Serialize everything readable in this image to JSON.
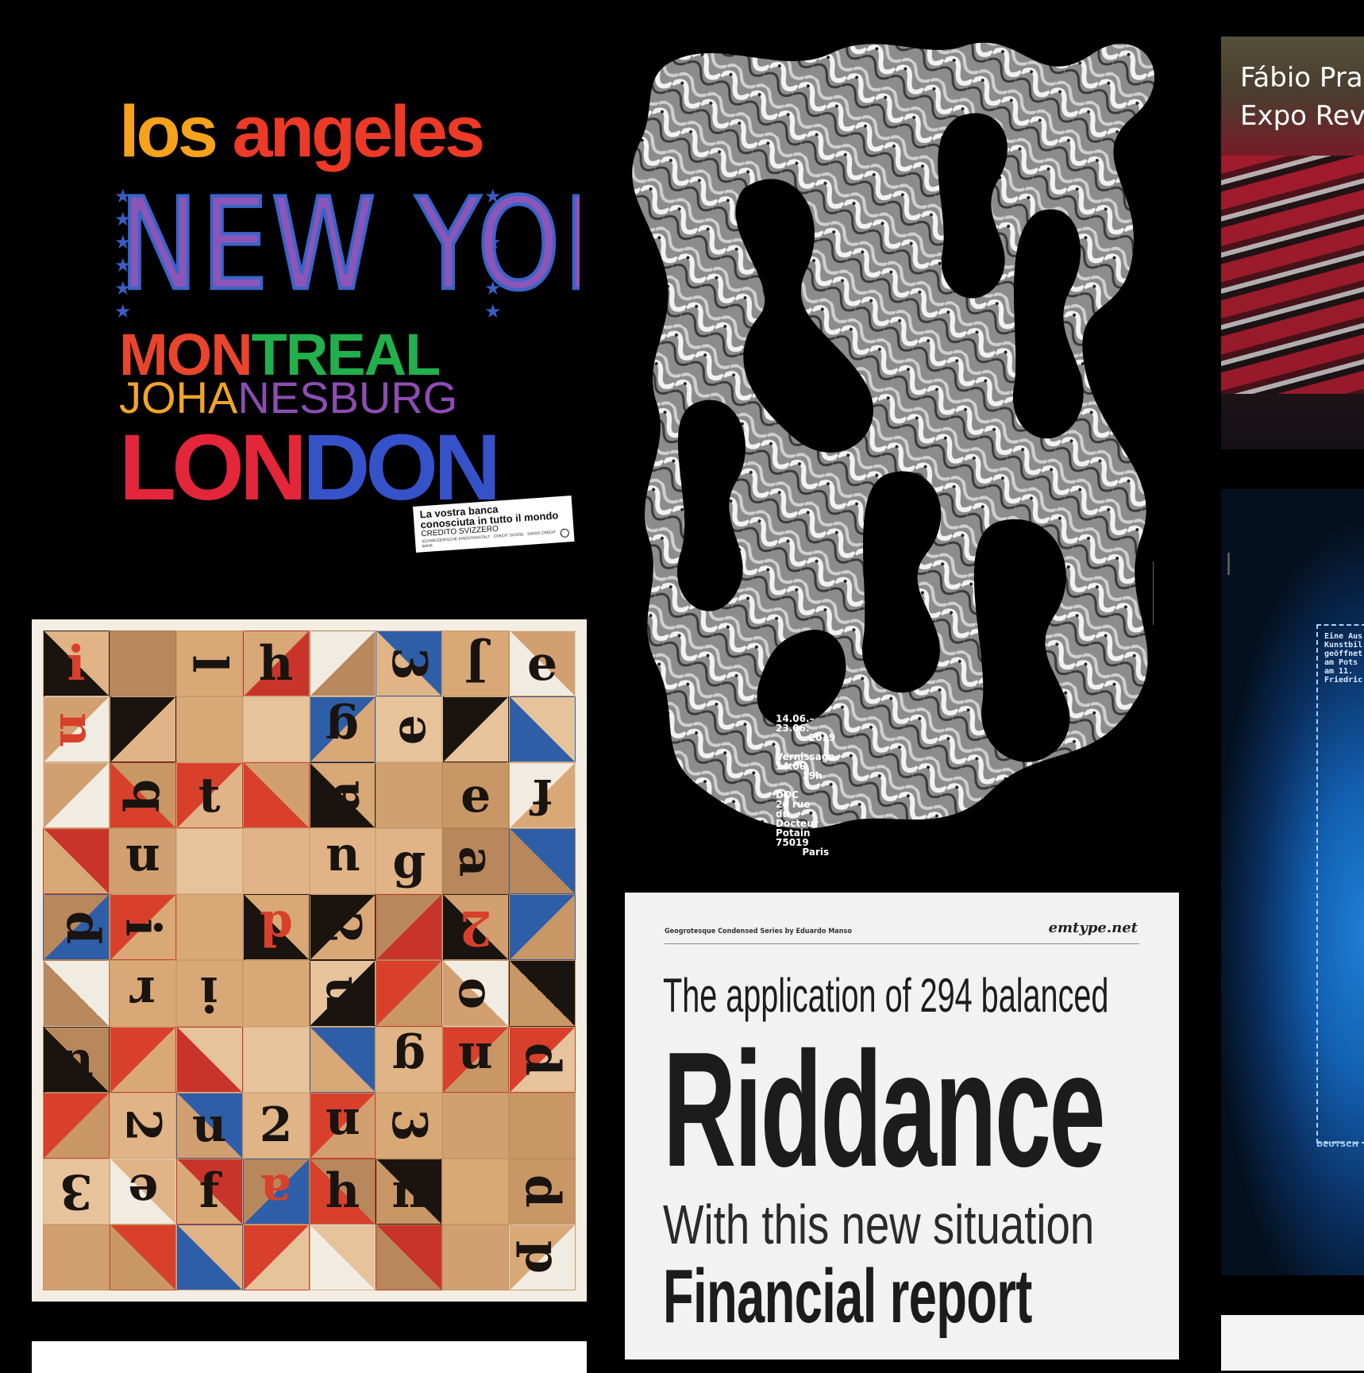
{
  "cities_poster": {
    "los_angeles_a": "los ",
    "los_angeles_b": "angeles",
    "new_york": "NEW YORK",
    "montreal_a": "MON",
    "montreal_b": "TREAL",
    "johannesburg_a": "JOHA",
    "johannesburg_b": "NESBURG",
    "london_a": "LON",
    "london_b": "DON",
    "star": "★",
    "ticket_line1": "La vostra banca",
    "ticket_line2": "conosciuta in tutto il mondo",
    "ticket_line3": "CREDITO SVIZZERO",
    "ticket_line4": "SCHWEIZERISCHE KREDITANSTALT · CREDIT SUISSE · SWISS CREDIT BANK"
  },
  "blob_poster": {
    "info": "14.06.–\n23.06.\n          2019\n\nVernissage\n14.06.\n        19h\n\nDOC\n26 rue\ndu\nDocteur\nPotain\n75019\n        Paris"
  },
  "specimen": {
    "header_left": "Geogrotesque Condensed Series by Eduardo Manso",
    "header_right": "emtype.net",
    "line1": "The application of 294 balanced",
    "line2": "Riddance",
    "line3": "With this new situation",
    "line4": "Financial report"
  },
  "card_fabio": {
    "line1": "Fábio Pra",
    "line2": "Expo Rev"
  },
  "card_blue": {
    "text": "Eine Aus\nKunstbil\ngeöffnet\nam Pots\nam 11.\nFriedric",
    "footer": "DEUTSCH"
  },
  "colors": {
    "background": "#000000",
    "la_orange": "#f7a21b",
    "la_red": "#ec3a26",
    "ny_purple": "#8b56b8",
    "london_blue": "#3552c9",
    "collage_kraft": "#d6a878"
  }
}
